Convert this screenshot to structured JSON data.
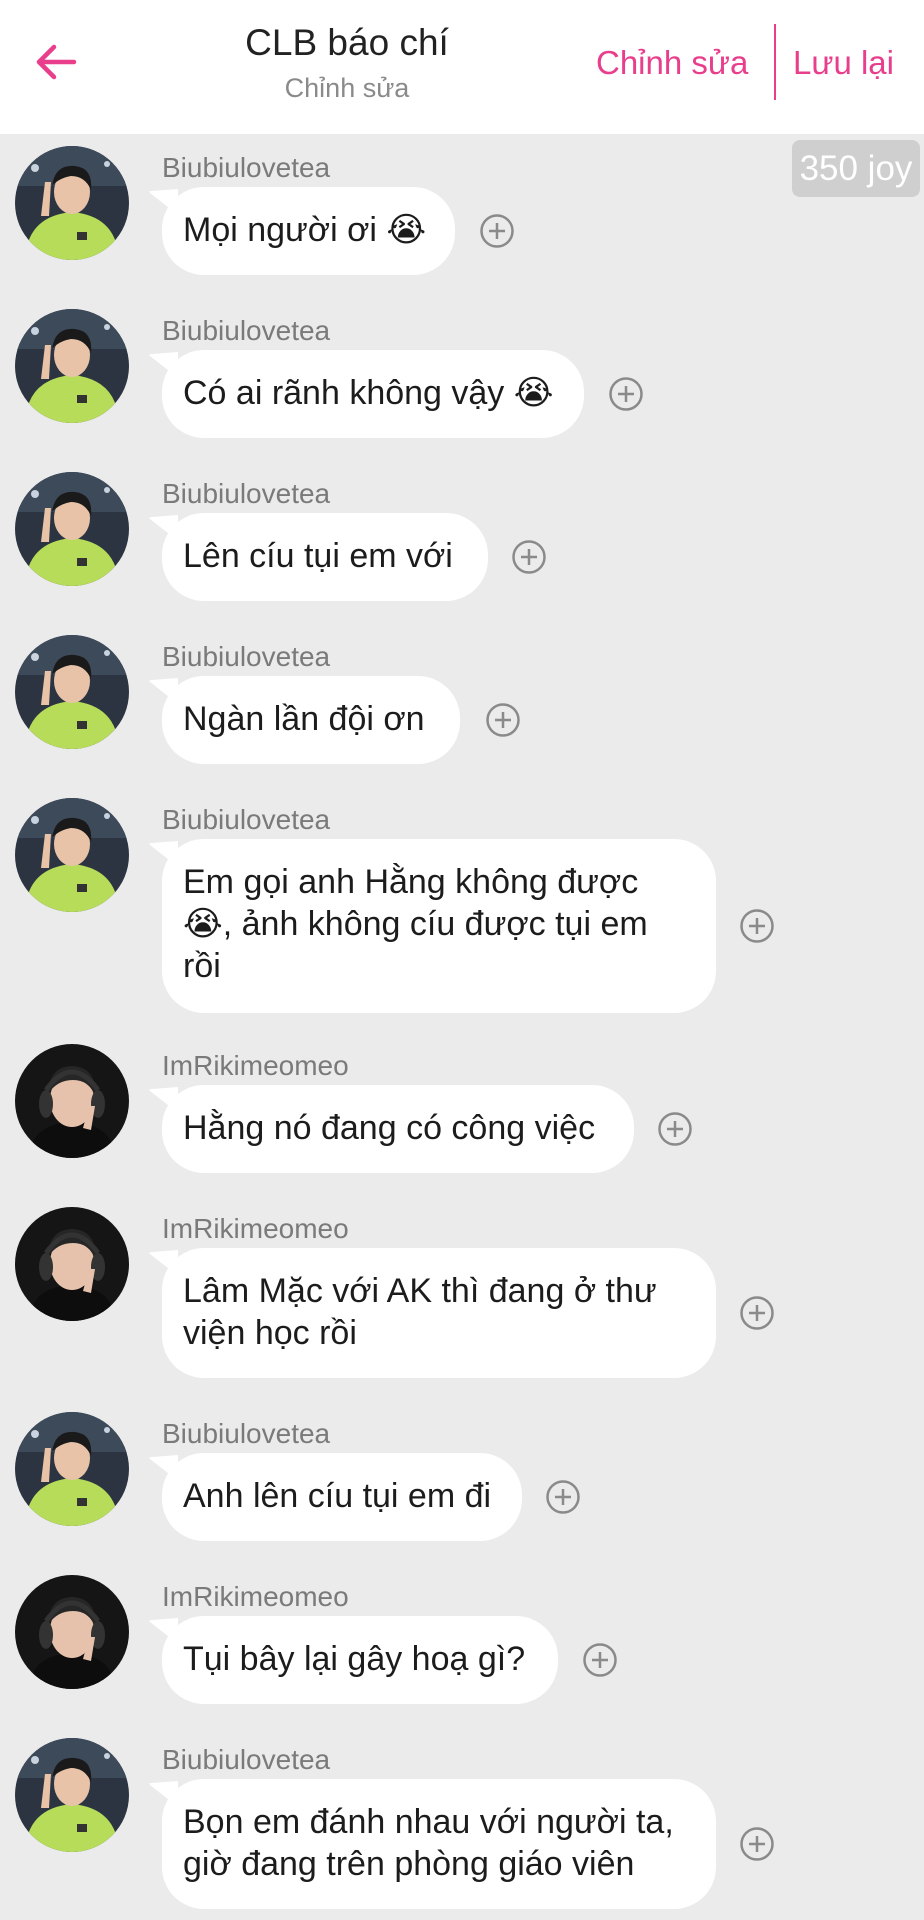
{
  "header": {
    "title": "CLB báo chí",
    "subtitle": "Chỉnh sửa",
    "edit_label": "Chỉnh sửa",
    "save_label": "Lưu lại",
    "accent_color": "#e83e8c"
  },
  "badge": {
    "label": "350 joy"
  },
  "messages": [
    {
      "user": "Biubiulovetea",
      "text": "Mọi người ơi 😭"
    },
    {
      "user": "Biubiulovetea",
      "text": "Có ai rãnh không vậy 😭"
    },
    {
      "user": "Biubiulovetea",
      "text": "Lên cíu tụi em với"
    },
    {
      "user": "Biubiulovetea",
      "text": "Ngàn lần đội ơn"
    },
    {
      "user": "Biubiulovetea",
      "text": "Em gọi anh Hằng không được 😭, ảnh không cíu được tụi em rồi"
    },
    {
      "user": "ImRikimeomeo",
      "text": "Hằng nó đang có công việc"
    },
    {
      "user": "ImRikimeomeo",
      "text": "Lâm Mặc với AK thì đang ở thư viện học rồi"
    },
    {
      "user": "Biubiulovetea",
      "text": "Anh lên cíu tụi em đi"
    },
    {
      "user": "ImRikimeomeo",
      "text": "Tụi bây lại gây hoạ gì?"
    },
    {
      "user": "Biubiulovetea",
      "text": "Bọn em đánh nhau với người ta, giờ đang trên phòng giáo viên"
    }
  ]
}
